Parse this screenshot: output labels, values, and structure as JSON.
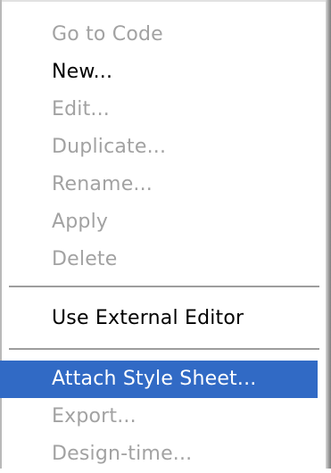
{
  "menu": {
    "items": [
      {
        "label": "Go to Code",
        "enabled": false,
        "selected": false
      },
      {
        "label": "New...",
        "enabled": true,
        "selected": false
      },
      {
        "label": "Edit...",
        "enabled": false,
        "selected": false
      },
      {
        "label": "Duplicate...",
        "enabled": false,
        "selected": false
      },
      {
        "label": "Rename...",
        "enabled": false,
        "selected": false
      },
      {
        "label": "Apply",
        "enabled": false,
        "selected": false
      },
      {
        "label": "Delete",
        "enabled": false,
        "selected": false
      },
      {
        "label": "Use External Editor",
        "enabled": true,
        "selected": false
      },
      {
        "label": "Attach Style Sheet...",
        "enabled": true,
        "selected": true
      },
      {
        "label": "Export...",
        "enabled": false,
        "selected": false
      },
      {
        "label": "Design-time...",
        "enabled": false,
        "selected": false
      }
    ]
  },
  "colors": {
    "highlight": "#316ac5",
    "disabled_text": "#a2a2a2",
    "enabled_text": "#000000"
  }
}
